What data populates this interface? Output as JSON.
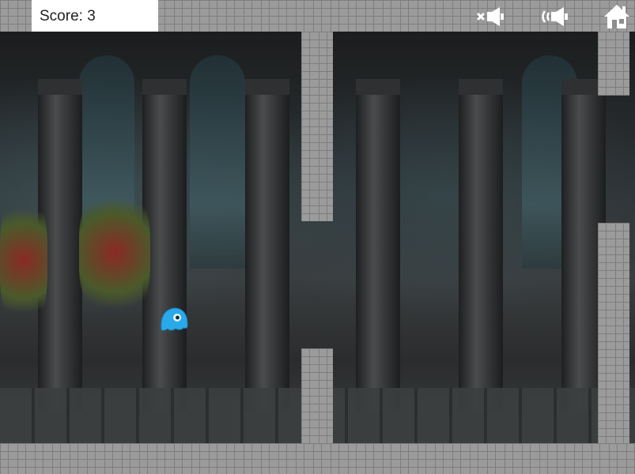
{
  "hud": {
    "score_text": "Score: 3",
    "mute_icon": "speaker-muted-icon",
    "sound_icon": "speaker-on-icon",
    "home_icon": "home-icon"
  },
  "colors": {
    "brick": "#9b9b9b",
    "mortar": "#7d7d7d",
    "score_bg": "#ffffff",
    "player": "#29a9ea",
    "icon": "#ffffff"
  },
  "player": {
    "icon": "blue-ghost-icon"
  }
}
